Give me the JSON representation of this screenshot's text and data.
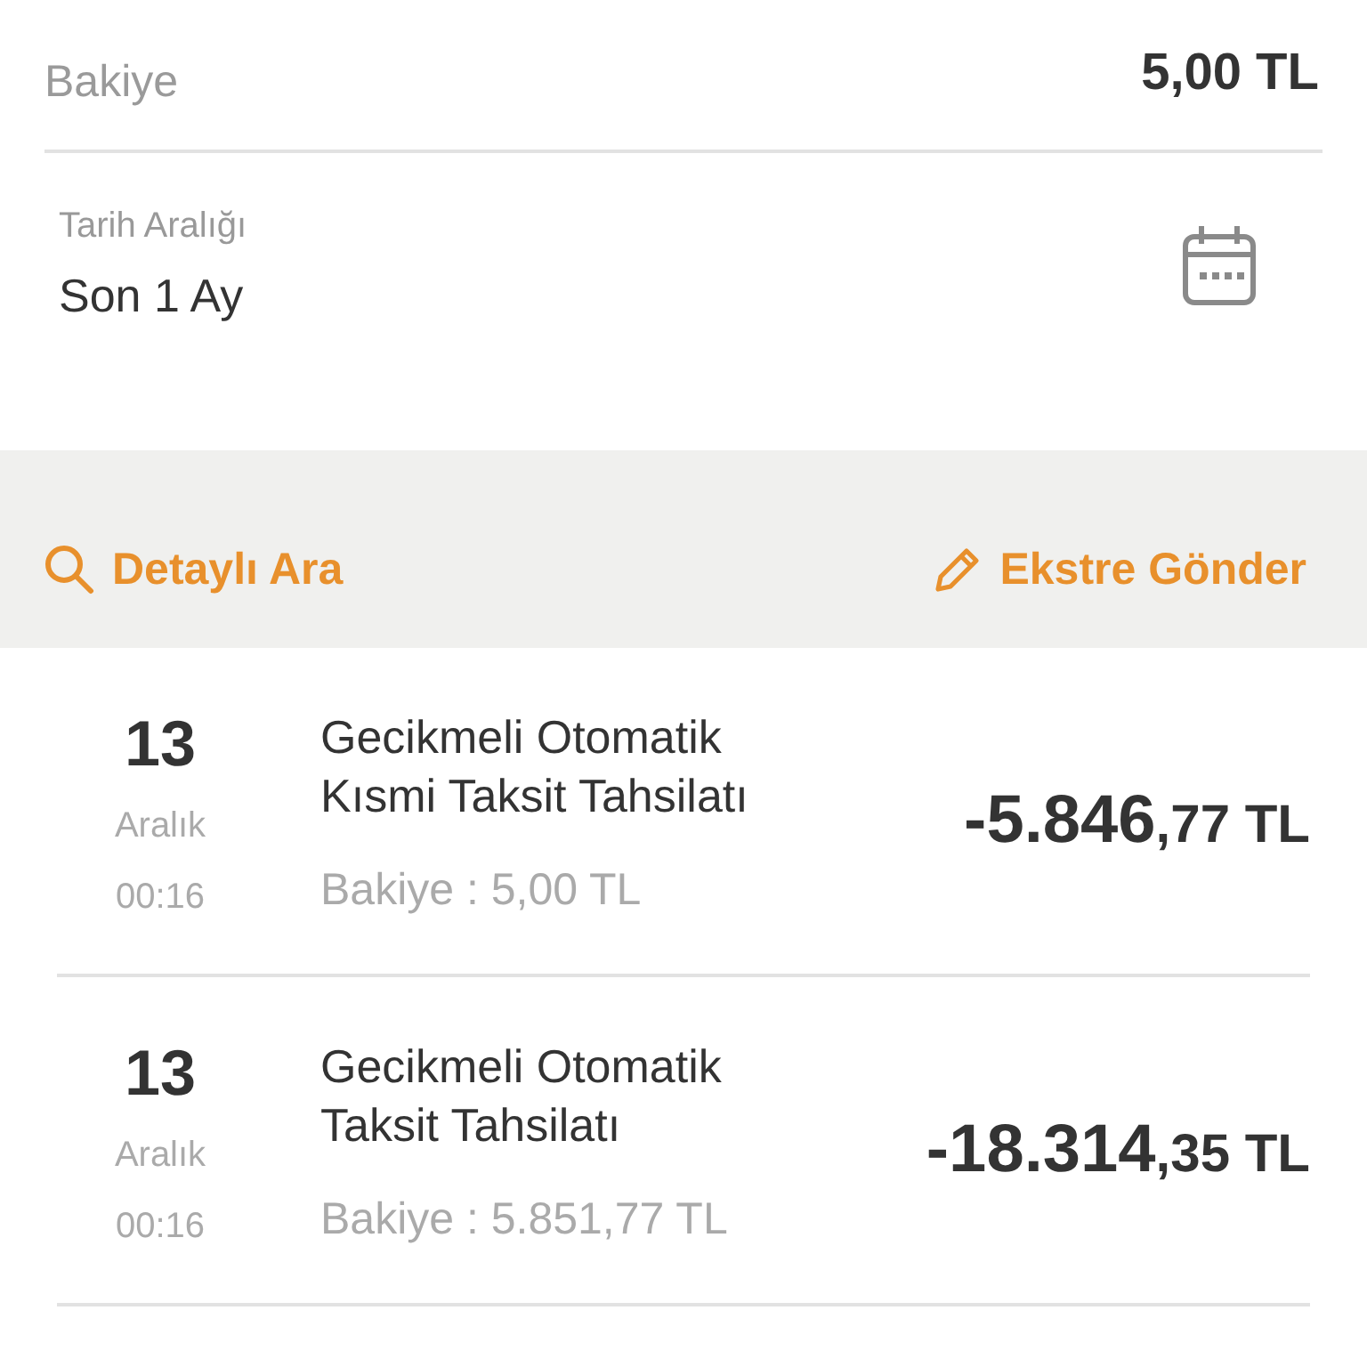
{
  "balance": {
    "label": "Bakiye",
    "value": "5,00 TL"
  },
  "date_filter": {
    "label": "Tarih Aralığı",
    "value": "Son 1 Ay"
  },
  "actions": [
    {
      "kind": "search",
      "label": "Detaylı Ara"
    },
    {
      "kind": "send",
      "label": "Ekstre Gönder"
    }
  ],
  "transactions": [
    {
      "day": "13",
      "month": "Aralık",
      "time": "00:16",
      "title": "Gecikmeli Otomatik Kısmi Taksit Tahsilatı",
      "balance": "Bakiye : 5,00 TL",
      "amount_main": "-5.846",
      "amount_fraction": ",77 TL"
    },
    {
      "day": "13",
      "month": "Aralık",
      "time": "00:16",
      "title": "Gecikmeli Otomatik Taksit Tahsilatı",
      "balance": "Bakiye : 5.851,77 TL",
      "amount_main": "-18.314",
      "amount_fraction": ",35 TL"
    }
  ]
}
